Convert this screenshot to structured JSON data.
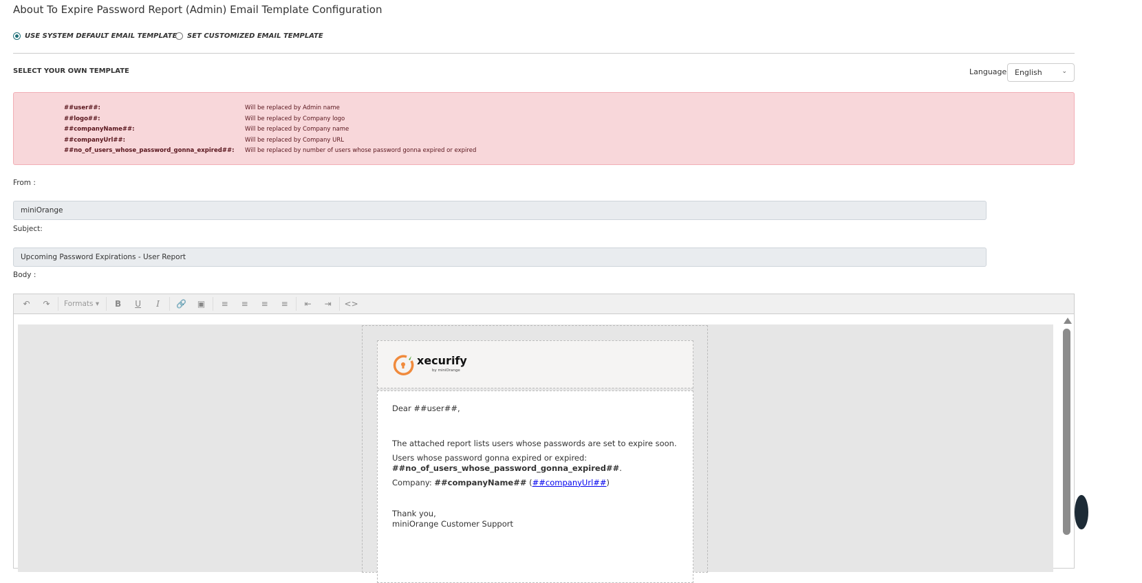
{
  "title": "About To Expire Password Report (Admin) Email Template Configuration",
  "options": {
    "default": "USE SYSTEM DEFAULT EMAIL TEMPLATE",
    "custom": "SET CUSTOMIZED EMAIL TEMPLATE"
  },
  "select_title": "SELECT YOUR OWN TEMPLATE",
  "language": {
    "label": "Language",
    "value": "English"
  },
  "placeholders": [
    {
      "key": "##user##:",
      "desc": "Will be replaced by Admin name"
    },
    {
      "key": "##logo##:",
      "desc": "Will be replaced by Company logo"
    },
    {
      "key": "##companyName##:",
      "desc": "Will be replaced by Company name"
    },
    {
      "key": "##companyUrl##:",
      "desc": "Will be replaced by Company URL"
    },
    {
      "key": "##no_of_users_whose_password_gonna_expired##:",
      "desc": "Will be replaced by number of users whose password gonna expired or expired"
    }
  ],
  "from": {
    "label": "From :",
    "value": "miniOrange"
  },
  "subject": {
    "label": "Subject:",
    "value": "Upcoming Password Expirations - User Report"
  },
  "body_label": "Body :",
  "toolbar": {
    "formats": "Formats"
  },
  "email": {
    "logo_text": "xecurify",
    "logo_sub": "by miniOrange",
    "greeting": "Dear ##user##,",
    "line1": "The attached report lists users whose passwords are set to expire soon.",
    "line2": "Users whose password gonna expired or expired:",
    "line2b": "##no_of_users_whose_password_gonna_expired##",
    "company_label": "Company: ",
    "company_name": "##companyName##",
    "company_url": "##companyUrl##",
    "thanks": "Thank you,",
    "signature": "miniOrange Customer Support"
  }
}
